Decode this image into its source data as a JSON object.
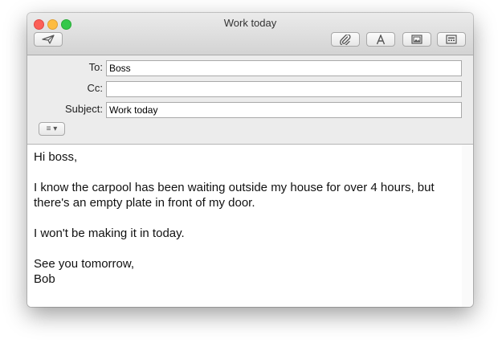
{
  "window": {
    "title": "Work today"
  },
  "toolbar": {
    "send_icon": "paper-plane-icon",
    "attach_icon": "paperclip-icon",
    "format_icon": "font-a-icon",
    "photo_icon": "photo-browser-icon",
    "template_icon": "stationery-icon"
  },
  "headers": {
    "to_label": "To:",
    "to_value": "Boss",
    "cc_label": "Cc:",
    "cc_value": "",
    "subject_label": "Subject:",
    "subject_value": "Work today",
    "header_menu_glyph": "≡ ▾"
  },
  "message": {
    "lines": [
      "Hi boss,",
      "I know the carpool has been waiting outside my house for over 4 hours, but there's an empty plate in front of my door.",
      "I won't be making it in today.",
      "See you tomorrow,",
      "Bob"
    ]
  }
}
